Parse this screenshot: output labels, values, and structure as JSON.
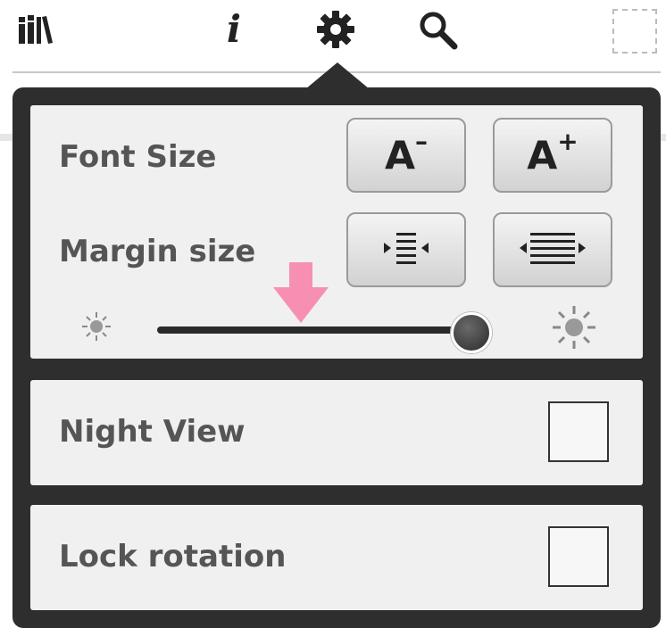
{
  "toolbar": {
    "icons": [
      "library-icon",
      "info-icon",
      "gear-icon",
      "search-icon",
      "placeholder-icon"
    ],
    "info_glyph": "i"
  },
  "settings": {
    "font_size_label": "Font Size",
    "margin_size_label": "Margin size",
    "font_decrease_label": "A",
    "font_increase_label": "A",
    "brightness_level": 0.95,
    "night_view_label": "Night View",
    "night_view_checked": false,
    "lock_rotation_label": "Lock rotation",
    "lock_rotation_checked": false
  },
  "colors": {
    "popup_bg": "#2e2e2e",
    "panel_bg": "#f0f0f0",
    "label_text": "#555555",
    "annotation_arrow": "#f78fb3"
  }
}
